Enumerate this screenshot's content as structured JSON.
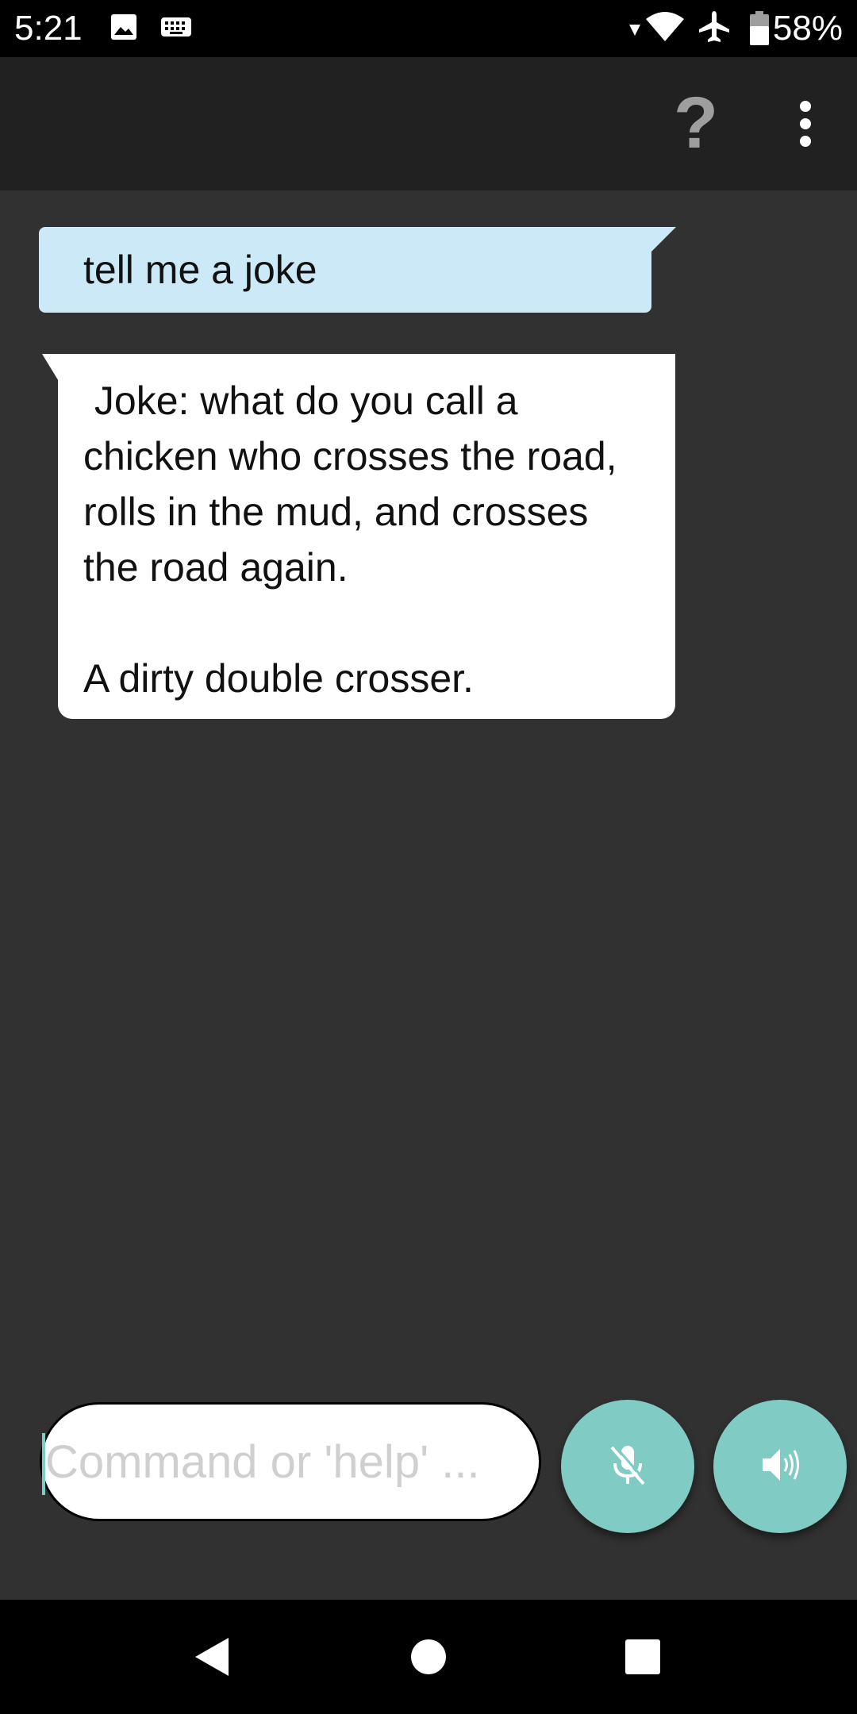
{
  "status_bar": {
    "time": "5:21",
    "battery": "58%",
    "icons": [
      "image-icon",
      "keyboard-icon",
      "wifi-icon",
      "airplane-icon",
      "battery-icon"
    ]
  },
  "app_bar": {
    "help_label": "?",
    "menu_icon": "more-vert-icon"
  },
  "chat": {
    "messages": [
      {
        "from": "user",
        "text": "tell me a joke"
      },
      {
        "from": "assistant",
        "text": " Joke: what do you call a chicken who crosses the road, rolls in the mud, and crosses the road again.\n\nA dirty double crosser."
      }
    ]
  },
  "input": {
    "value": "",
    "placeholder": "Command or 'help' ..."
  },
  "buttons": {
    "mic_icon": "mic-off-icon",
    "speaker_icon": "volume-icon"
  },
  "nav_bar": {
    "icons": [
      "back-icon",
      "home-icon",
      "recents-icon"
    ]
  },
  "colors": {
    "background": "#313131",
    "app_bar": "#212121",
    "user_bubble": "#cce9f8",
    "assistant_bubble": "#ffffff",
    "accent": "#80cbc4"
  }
}
